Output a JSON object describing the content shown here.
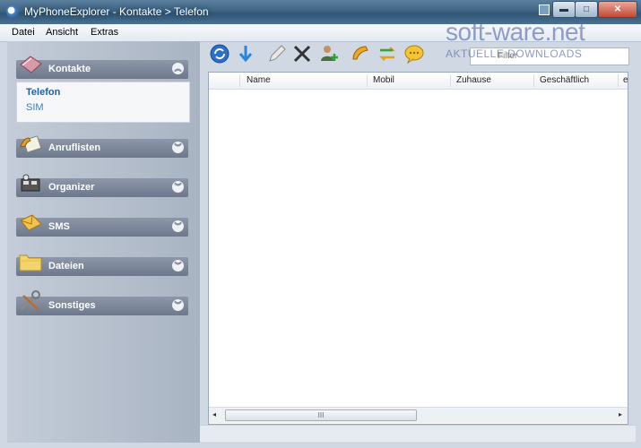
{
  "window": {
    "title": "MyPhoneExplorer -  Kontakte > Telefon",
    "min_label": "▬",
    "max_label": "□",
    "close_label": "✕"
  },
  "menu": [
    "Datei",
    "Ansicht",
    "Extras"
  ],
  "sidebar": {
    "groups": [
      {
        "label": "Kontakte",
        "icon": "address-book-icon",
        "expanded": true,
        "items": [
          "Telefon",
          "SIM"
        ]
      },
      {
        "label": "Anruflisten",
        "icon": "call-list-icon"
      },
      {
        "label": "Organizer",
        "icon": "organizer-icon"
      },
      {
        "label": "SMS",
        "icon": "sms-envelope-icon"
      },
      {
        "label": "Dateien",
        "icon": "folder-icon"
      },
      {
        "label": "Sonstiges",
        "icon": "tools-icon"
      }
    ]
  },
  "toolbar": {
    "icons": [
      "refresh-icon",
      "download-arrow-icon",
      "edit-icon",
      "delete-icon",
      "add-contact-icon",
      "call-icon",
      "sync-icon",
      "message-icon"
    ],
    "filter_placeholder": "Filter"
  },
  "table": {
    "columns": [
      "Name",
      "Mobil",
      "Zuhause",
      "Geschäftlich",
      "e"
    ]
  },
  "scrollbar": {
    "grip": "III",
    "left": "◂",
    "right": "▸"
  },
  "watermark": {
    "top": "soft-ware.net",
    "bottom": "AKTUELLE DOWNLOADS"
  },
  "colors": {
    "accent_link": "#3d7cc0",
    "titlebar": "#3f6584"
  }
}
